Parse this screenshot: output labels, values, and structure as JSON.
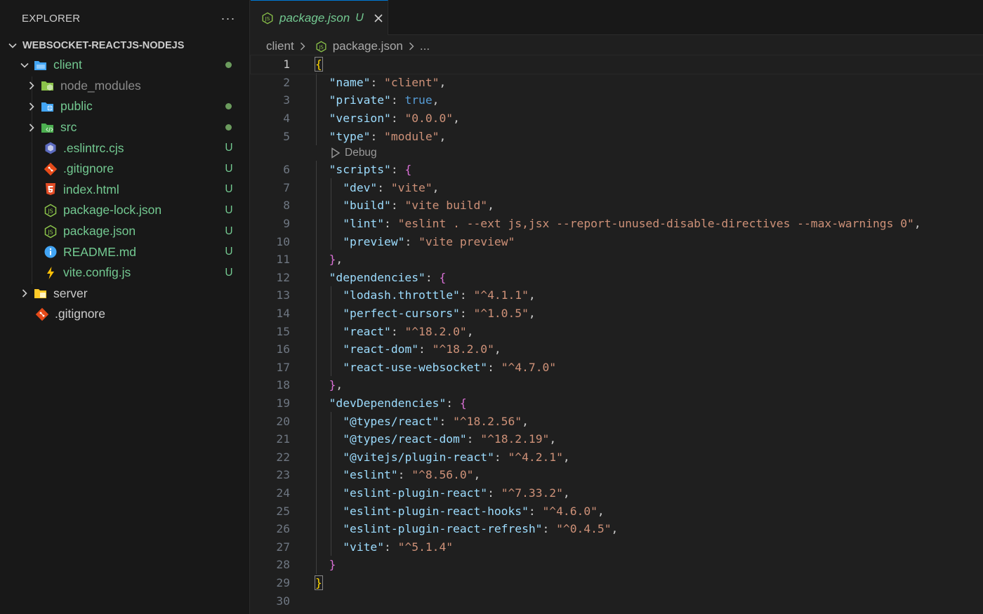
{
  "explorer": {
    "title": "EXPLORER",
    "more_label": "···",
    "project": "WEBSOCKET-REACTJS-NODEJS",
    "items": [
      {
        "label": "client",
        "icon": "folder-open-blue-icon",
        "status": "dot"
      },
      {
        "label": "node_modules",
        "icon": "folder-node-icon",
        "status": ""
      },
      {
        "label": "public",
        "icon": "folder-public-icon",
        "status": "dot"
      },
      {
        "label": "src",
        "icon": "folder-src-icon",
        "status": "dot"
      },
      {
        "label": ".eslintrc.cjs",
        "icon": "eslint-icon",
        "status": "U"
      },
      {
        "label": ".gitignore",
        "icon": "git-icon",
        "status": "U"
      },
      {
        "label": "index.html",
        "icon": "html5-icon",
        "status": "U"
      },
      {
        "label": "package-lock.json",
        "icon": "nodejs-icon",
        "status": "U"
      },
      {
        "label": "package.json",
        "icon": "nodejs-icon",
        "status": "U"
      },
      {
        "label": "README.md",
        "icon": "info-icon",
        "status": "U"
      },
      {
        "label": "vite.config.js",
        "icon": "vite-icon",
        "status": "U"
      },
      {
        "label": "server",
        "icon": "folder-yellow-icon",
        "status": ""
      },
      {
        "label": ".gitignore",
        "icon": "git-icon",
        "status": ""
      }
    ]
  },
  "tab": {
    "label": "package.json",
    "status": "U"
  },
  "breadcrumb": {
    "folder": "client",
    "file": "package.json",
    "more": "..."
  },
  "codelens": {
    "label": "Debug"
  },
  "line_numbers": [
    "1",
    "2",
    "3",
    "4",
    "5",
    "6",
    "7",
    "8",
    "9",
    "10",
    "11",
    "12",
    "13",
    "14",
    "15",
    "16",
    "17",
    "18",
    "19",
    "20",
    "21",
    "22",
    "23",
    "24",
    "25",
    "26",
    "27",
    "28",
    "29",
    "30"
  ],
  "code": {
    "name_key": "\"name\"",
    "name_val": "\"client\"",
    "private_key": "\"private\"",
    "private_val": "true",
    "version_key": "\"version\"",
    "version_val": "\"0.0.0\"",
    "type_key": "\"type\"",
    "type_val": "\"module\"",
    "scripts_key": "\"scripts\"",
    "dev_key": "\"dev\"",
    "dev_val": "\"vite\"",
    "build_key": "\"build\"",
    "build_val": "\"vite build\"",
    "lint_key": "\"lint\"",
    "lint_val": "\"eslint . --ext js,jsx --report-unused-disable-directives --max-warnings 0\"",
    "preview_key": "\"preview\"",
    "preview_val": "\"vite preview\"",
    "dependencies_key": "\"dependencies\"",
    "lodash_key": "\"lodash.throttle\"",
    "lodash_val": "\"^4.1.1\"",
    "pc_key": "\"perfect-cursors\"",
    "pc_val": "\"^1.0.5\"",
    "react_key": "\"react\"",
    "react_val": "\"^18.2.0\"",
    "reactdom_key": "\"react-dom\"",
    "reactdom_val": "\"^18.2.0\"",
    "ruw_key": "\"react-use-websocket\"",
    "ruw_val": "\"^4.7.0\"",
    "devdeps_key": "\"devDependencies\"",
    "tr_key": "\"@types/react\"",
    "tr_val": "\"^18.2.56\"",
    "trd_key": "\"@types/react-dom\"",
    "trd_val": "\"^18.2.19\"",
    "vpr_key": "\"@vitejs/plugin-react\"",
    "vpr_val": "\"^4.2.1\"",
    "eslint_key": "\"eslint\"",
    "eslint_val": "\"^8.56.0\"",
    "epr_key": "\"eslint-plugin-react\"",
    "epr_val": "\"^7.33.2\"",
    "eprh_key": "\"eslint-plugin-react-hooks\"",
    "eprh_val": "\"^4.6.0\"",
    "eprr_key": "\"eslint-plugin-react-refresh\"",
    "eprr_val": "\"^0.4.5\"",
    "vite_key": "\"vite\"",
    "vite_val": "\"^5.1.4\""
  },
  "colors": {
    "key": "#9cdcfe",
    "string": "#ce9178",
    "boolean": "#569cd6",
    "bracket_level1": "#ffd700",
    "bracket_level2": "#da70d6",
    "untracked": "#73c991",
    "accent": "#0078d4"
  }
}
